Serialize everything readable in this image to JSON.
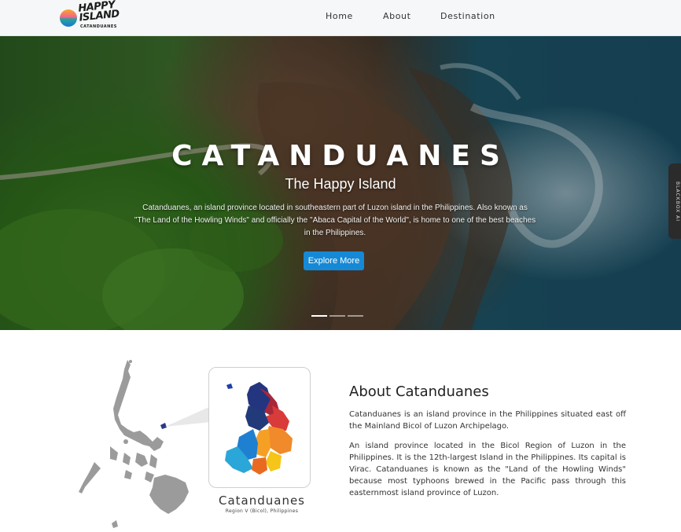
{
  "nav": {
    "logo_text": "HAPPY\nISLAND",
    "logo_sub": "CATANDUANES",
    "links": [
      "Home",
      "About",
      "Destination"
    ]
  },
  "hero": {
    "title": "CATANDUANES",
    "subtitle": "The Happy Island",
    "description": "Catanduanes, an island province located in southeastern part of Luzon island in the Philippines. Also known as \"The Land of the Howling Winds\" and officially the \"Abaca Capital of the World\", is home to one of the best beaches in the Philippines.",
    "button": "Explore More",
    "active_slide": 1,
    "slide_count": 3
  },
  "side_tab": {
    "label": "BLACKBOX AI"
  },
  "about": {
    "map_title": "Catanduanes",
    "map_subtitle": "Region V (Bicol), Philippines",
    "heading": "About Catanduanes",
    "paragraph1": "Catanduanes is an island province in the Philippines situated east off the Mainland Bicol of Luzon Archipelago.",
    "paragraph2": "An island province located in the Bicol Region of Luzon in the Philippines. It is the 12th-largest Island in the Philippines. Its capital is Virac. Catanduanes is known as the \"Land of the Howling Winds\" because most typhoons brewed in the Pacific pass through this easternmost island province of Luzon."
  },
  "colors": {
    "accent": "#1589d6",
    "nav_bg": "#f6f7f8",
    "map_gray": "#9b9b9b",
    "region_colors": [
      "#24357f",
      "#d93a3a",
      "#f08a2a",
      "#f5c518",
      "#1f7fd0",
      "#2aa7d8"
    ]
  }
}
